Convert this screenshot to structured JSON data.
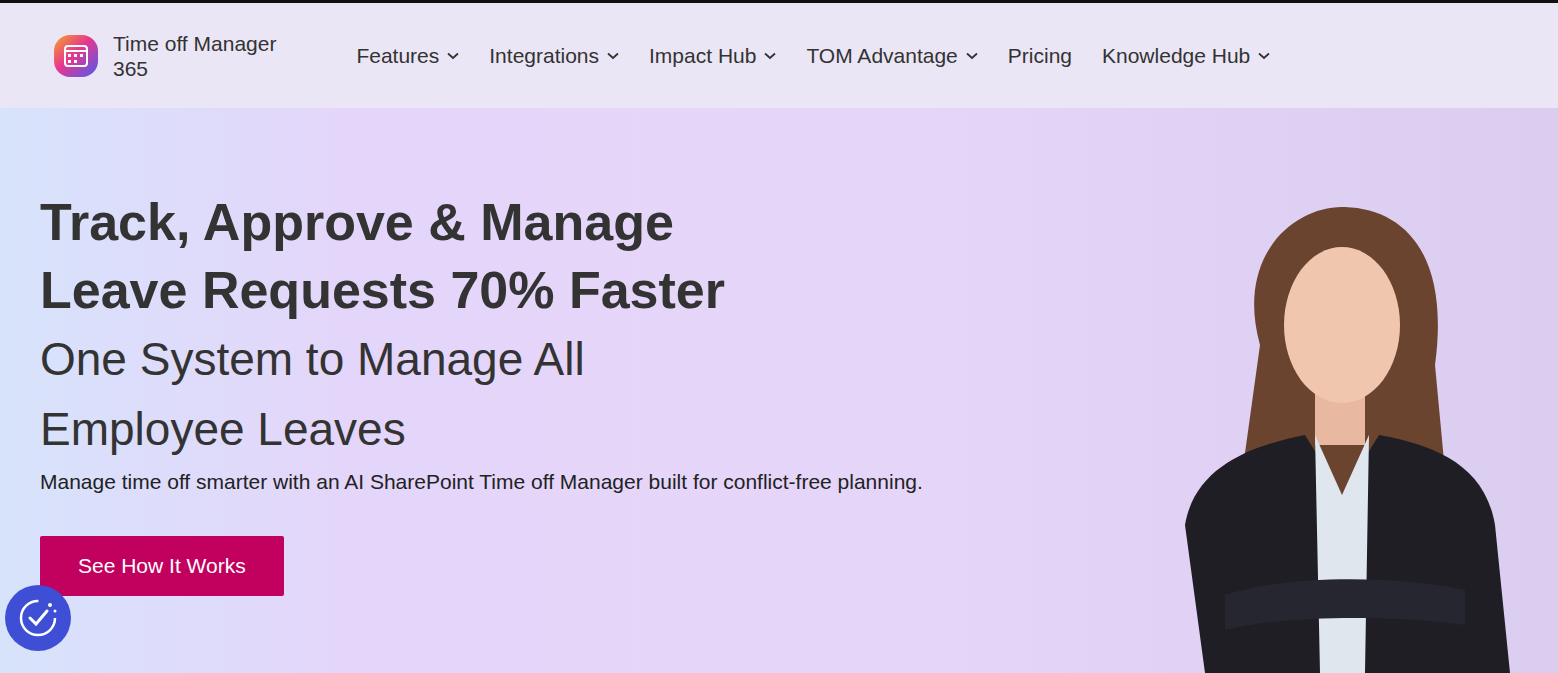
{
  "logo": {
    "line1": "Time off Manager",
    "line2": "365"
  },
  "nav": [
    {
      "label": "Features",
      "has_menu": true
    },
    {
      "label": "Integrations",
      "has_menu": true
    },
    {
      "label": "Impact Hub",
      "has_menu": true
    },
    {
      "label": "TOM Advantage",
      "has_menu": true
    },
    {
      "label": "Pricing",
      "has_menu": false
    },
    {
      "label": "Knowledge Hub",
      "has_menu": true
    }
  ],
  "hero": {
    "headline": [
      "Track, Approve & Manage",
      "Leave Requests 70% Faster"
    ],
    "subtitle": [
      "One System to Manage All",
      "Employee Leaves"
    ],
    "description": "Manage time off smarter with an AI SharePoint Time off Manager built for conflict-free planning.",
    "button": "See How It Works"
  }
}
